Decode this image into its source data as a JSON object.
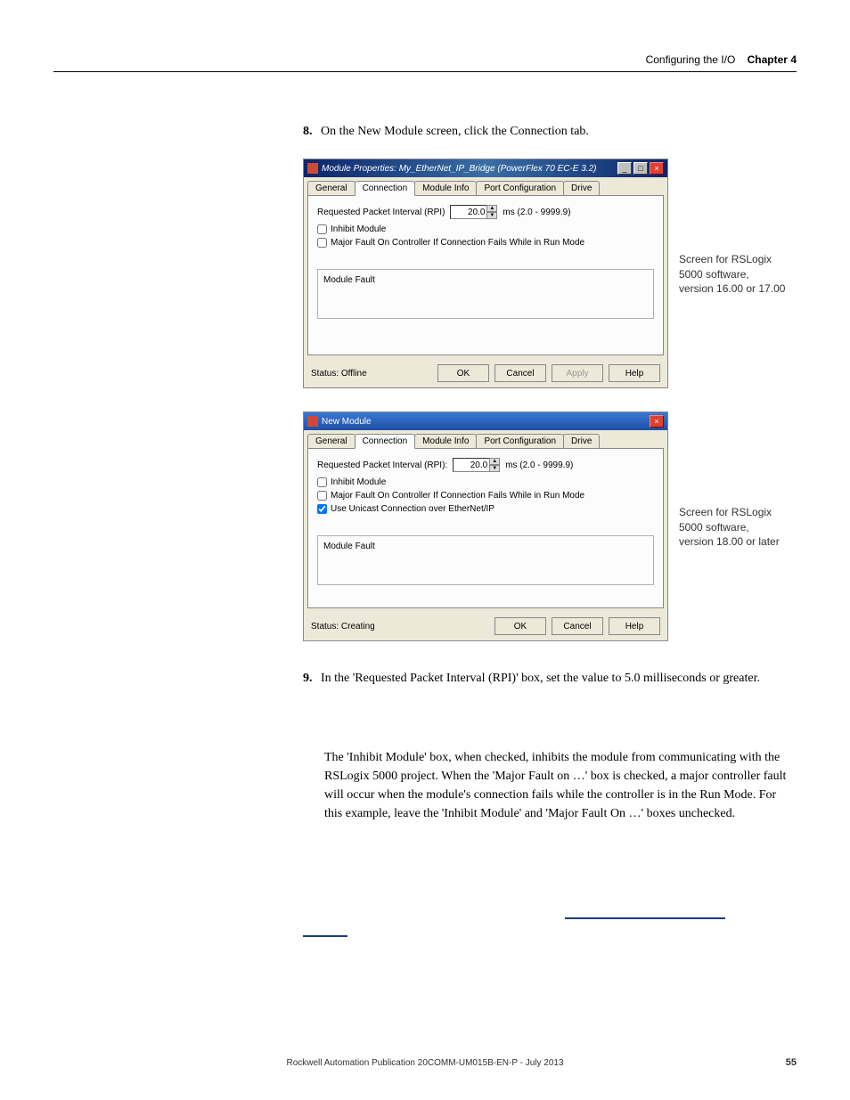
{
  "header": {
    "section_title": "Configuring the I/O",
    "chapter_label": "Chapter 4"
  },
  "steps": {
    "s8_num": "8.",
    "s8_text": "On the New Module screen, click the Connection tab.",
    "s9_num": "9.",
    "s9_text": "In the 'Requested Packet Interval (RPI)' box, set the value to 5.0 milliseconds or greater."
  },
  "dialog1": {
    "title": "Module Properties: My_EtherNet_IP_Bridge (PowerFlex 70 EC-E 3.2)",
    "tabs": {
      "general": "General",
      "connection": "Connection",
      "module_info": "Module Info",
      "port_config": "Port Configuration",
      "drive": "Drive"
    },
    "rpi_label": "Requested Packet Interval (RPI)",
    "rpi_value": "20.0",
    "rpi_unit": "ms  (2.0 - 9999.9)",
    "inhibit": "Inhibit Module",
    "major_fault": "Major Fault On Controller If Connection Fails While in Run Mode",
    "module_fault_legend": "Module Fault",
    "status_label": "Status: Offline",
    "ok": "OK",
    "cancel": "Cancel",
    "apply": "Apply",
    "help": "Help"
  },
  "caption1": "Screen for RSLogix 5000 software, version 16.00 or 17.00",
  "dialog2": {
    "title": "New Module",
    "tabs": {
      "general": "General",
      "connection": "Connection",
      "module_info": "Module Info",
      "port_config": "Port Configuration",
      "drive": "Drive"
    },
    "rpi_label": "Requested Packet Interval (RPI):",
    "rpi_value": "20.0",
    "rpi_unit": "ms  (2.0 - 9999.9)",
    "inhibit": "Inhibit Module",
    "major_fault": "Major Fault On Controller If Connection Fails While in Run Mode",
    "unicast": "Use Unicast Connection over EtherNet/IP",
    "module_fault_legend": "Module Fault",
    "status_label": "Status: Creating",
    "ok": "OK",
    "cancel": "Cancel",
    "help": "Help"
  },
  "caption2": "Screen for RSLogix 5000 software, version 18.00 or later",
  "body_para": "The 'Inhibit Module' box, when checked, inhibits the module from communicating with the RSLogix 5000 project. When the 'Major Fault on …' box is checked, a major controller fault will occur when the module's connection fails while the controller is in the Run Mode. For this example, leave the 'Inhibit Module' and 'Major Fault On …' boxes unchecked.",
  "footer": {
    "pub": "Rockwell Automation Publication  20COMM-UM015B-EN-P - July 2013",
    "page": "55"
  }
}
